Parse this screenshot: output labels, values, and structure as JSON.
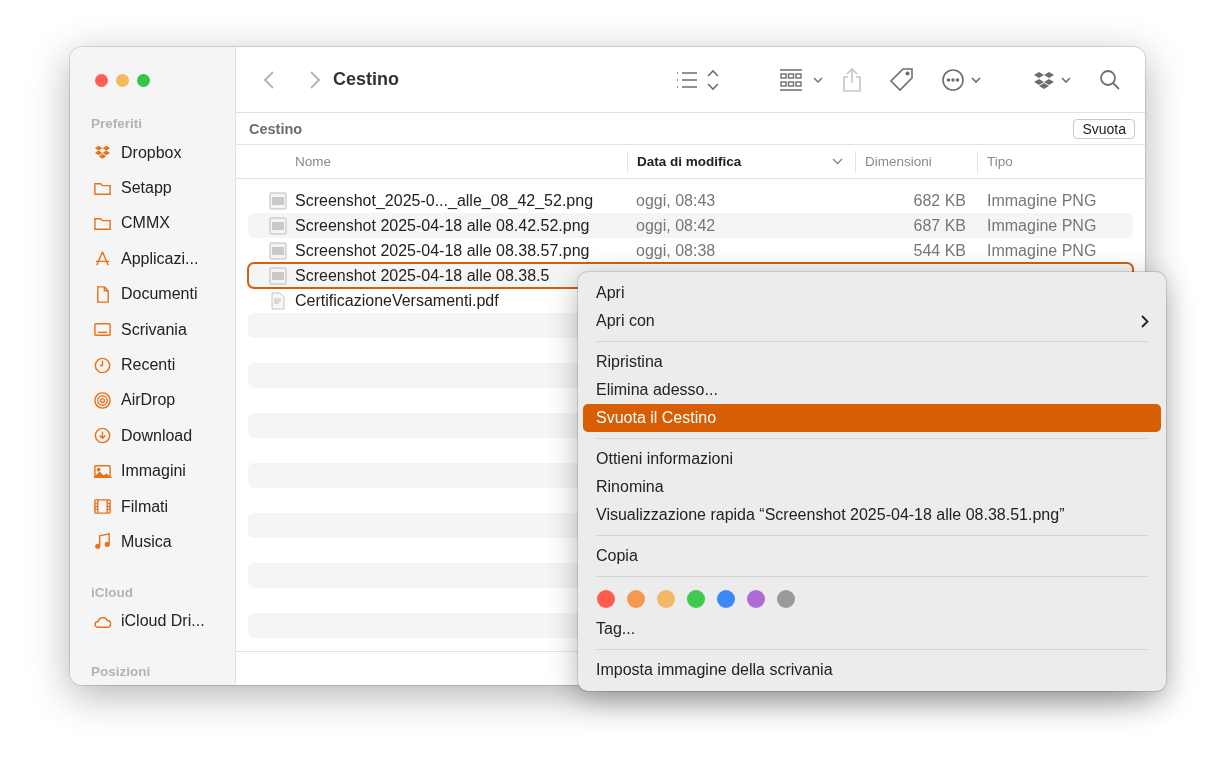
{
  "window": {
    "title": "Cestino"
  },
  "sidebar": {
    "sections": [
      {
        "title": "Preferiti",
        "items": [
          {
            "label": "Dropbox",
            "kind": "dropbox"
          },
          {
            "label": "Setapp",
            "kind": "folder"
          },
          {
            "label": "CMMX",
            "kind": "folder"
          },
          {
            "label": "Applicazi...",
            "kind": "apps"
          },
          {
            "label": "Documenti",
            "kind": "doc"
          },
          {
            "label": "Scrivania",
            "kind": "desktop"
          },
          {
            "label": "Recenti",
            "kind": "clock"
          },
          {
            "label": "AirDrop",
            "kind": "airdrop"
          },
          {
            "label": "Download",
            "kind": "download"
          },
          {
            "label": "Immagini",
            "kind": "photo"
          },
          {
            "label": "Filmati",
            "kind": "film"
          },
          {
            "label": "Musica",
            "kind": "music"
          }
        ]
      },
      {
        "title": "iCloud",
        "items": [
          {
            "label": "iCloud Dri...",
            "kind": "cloud"
          }
        ]
      },
      {
        "title": "Posizioni"
      }
    ]
  },
  "path_bar": {
    "title": "Cestino",
    "button": "Svuota"
  },
  "table": {
    "columns": [
      {
        "label": "Nome",
        "sorted": false
      },
      {
        "label": "Data di modifica",
        "sorted": true
      },
      {
        "label": "Dimensioni",
        "sorted": false
      },
      {
        "label": "Tipo",
        "sorted": false
      }
    ],
    "rows": [
      {
        "kind": "image",
        "name": "Screenshot_2025-0..._alle_08_42_52.png",
        "date": "oggi, 08:43",
        "size": "682 KB",
        "type": "Immagine PNG",
        "selected": false
      },
      {
        "kind": "image",
        "name": "Screenshot 2025-04-18 alle 08.42.52.png",
        "date": "oggi, 08:42",
        "size": "687 KB",
        "type": "Immagine PNG",
        "selected": false
      },
      {
        "kind": "image",
        "name": "Screenshot 2025-04-18 alle 08.38.57.png",
        "date": "oggi, 08:38",
        "size": "544 KB",
        "type": "Immagine PNG",
        "selected": false
      },
      {
        "kind": "image",
        "name": "Screenshot 2025-04-18 alle 08.38.5",
        "selected": true
      },
      {
        "kind": "pdf",
        "name": "CertificazioneVersamenti.pdf",
        "selected": false
      }
    ]
  },
  "context_menu": {
    "items": [
      {
        "kind": "item",
        "label": "Apri",
        "highlighted": false,
        "submenu": false
      },
      {
        "kind": "item",
        "label": "Apri con",
        "highlighted": false,
        "submenu": true
      },
      {
        "kind": "separator"
      },
      {
        "kind": "item",
        "label": "Ripristina",
        "highlighted": false,
        "submenu": false
      },
      {
        "kind": "item",
        "label": "Elimina adesso...",
        "highlighted": false,
        "submenu": false
      },
      {
        "kind": "item",
        "label": "Svuota il Cestino",
        "highlighted": true,
        "submenu": false
      },
      {
        "kind": "separator"
      },
      {
        "kind": "item",
        "label": "Ottieni informazioni",
        "highlighted": false,
        "submenu": false
      },
      {
        "kind": "item",
        "label": "Rinomina",
        "highlighted": false,
        "submenu": false
      },
      {
        "kind": "item",
        "label": "Visualizzazione rapida “Screenshot 2025-04-18 alle 08.38.51.png”",
        "highlighted": false,
        "submenu": false
      },
      {
        "kind": "separator"
      },
      {
        "kind": "item",
        "label": "Copia",
        "highlighted": false,
        "submenu": false
      },
      {
        "kind": "separator"
      },
      {
        "kind": "tags",
        "colors": [
          {
            "color": "#ff5b4f"
          },
          {
            "color": "#f19a50"
          },
          {
            "color": "#f4b766"
          },
          {
            "color": "#3fc94f"
          },
          {
            "color": "#3a89f7"
          },
          {
            "color": "#ad6bd3"
          },
          {
            "color": "#9a9a9a"
          }
        ]
      },
      {
        "kind": "item",
        "label": "Tag...",
        "highlighted": false,
        "submenu": false
      },
      {
        "kind": "separator"
      },
      {
        "kind": "item",
        "label": "Imposta immagine della scrivania",
        "highlighted": false,
        "submenu": false
      }
    ]
  }
}
